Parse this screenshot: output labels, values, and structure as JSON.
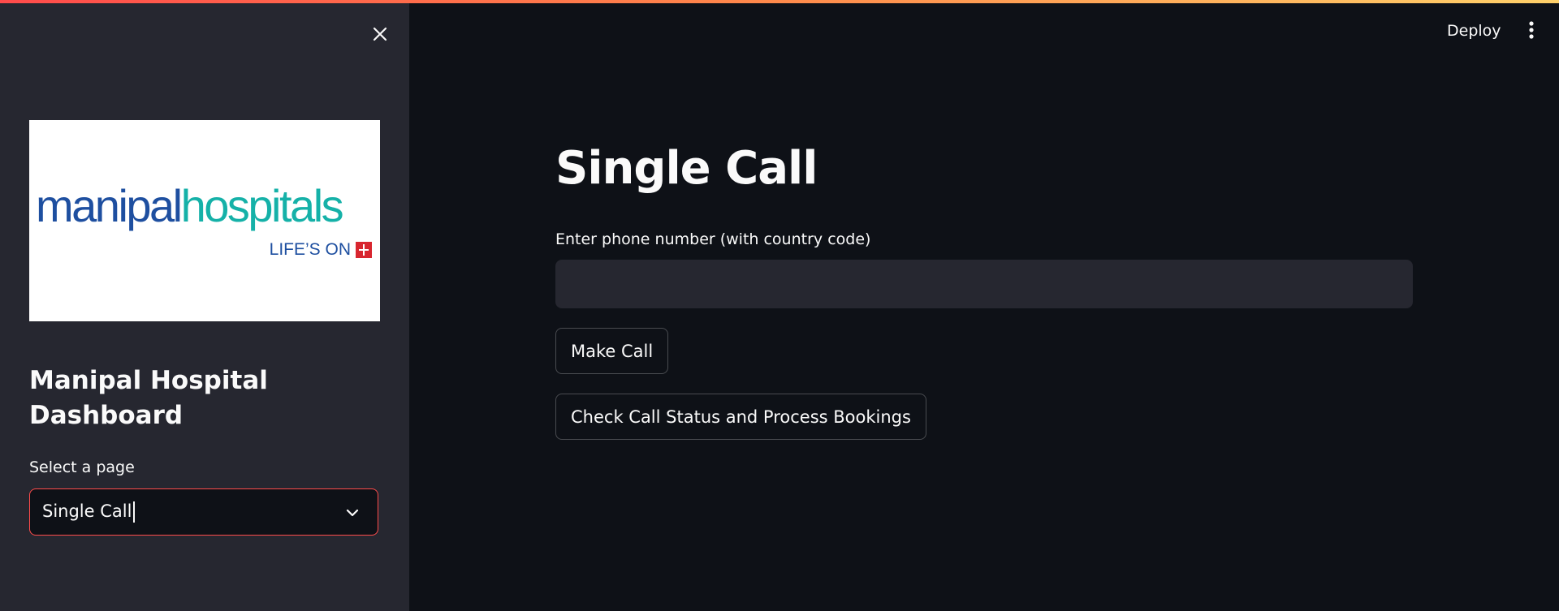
{
  "app": {
    "accent_color": "#ff4b4b",
    "sidebar_bg": "#262730",
    "main_bg": "#0e1117"
  },
  "header": {
    "deploy_label": "Deploy",
    "menu_icon": "kebab-vertical-icon"
  },
  "sidebar": {
    "close_icon": "close-icon",
    "logo": {
      "part1": "manipal",
      "part2": "hospitals",
      "tagline": "LIFE’S ON",
      "part1_color": "#1e4fa0",
      "part2_color": "#15b1a8",
      "mark_color": "#d8262f"
    },
    "title": "Manipal Hospital Dashboard",
    "select": {
      "label": "Select a page",
      "value": "Single Call",
      "icon": "chevron-down-icon"
    }
  },
  "main": {
    "title": "Single Call",
    "phone": {
      "label": "Enter phone number (with country code)",
      "value": "",
      "placeholder": ""
    },
    "buttons": {
      "make_call": "Make Call",
      "check_status": "Check Call Status and Process Bookings"
    }
  }
}
